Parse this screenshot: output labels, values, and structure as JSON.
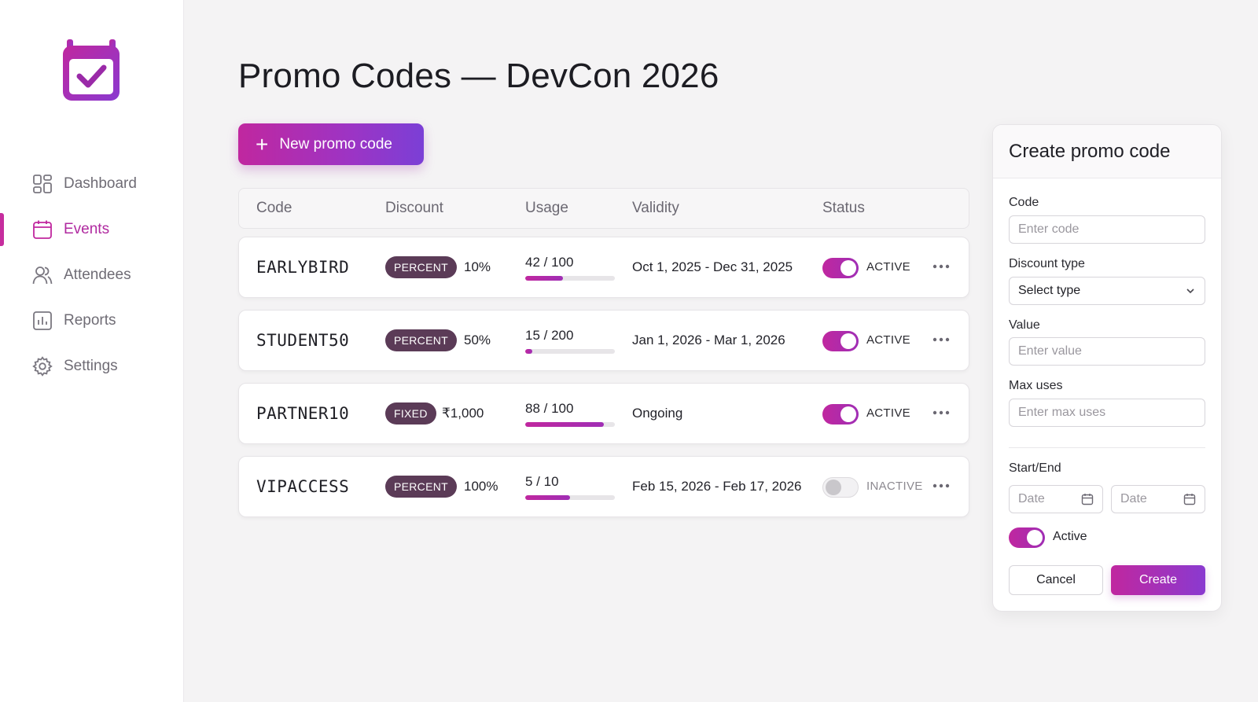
{
  "sidebar": {
    "items": [
      {
        "label": "Dashboard",
        "icon": "dashboard-icon"
      },
      {
        "label": "Events",
        "icon": "calendar-icon",
        "active": true
      },
      {
        "label": "Attendees",
        "icon": "users-icon"
      },
      {
        "label": "Reports",
        "icon": "chart-icon"
      },
      {
        "label": "Settings",
        "icon": "gear-icon"
      }
    ]
  },
  "page": {
    "title": "Promo Codes — DevCon 2026",
    "new_button": "New promo code"
  },
  "table": {
    "headers": [
      "Code",
      "Discount",
      "Usage",
      "Validity",
      "Status"
    ],
    "rows": [
      {
        "code": "EARLYBIRD",
        "type": "PERCENT",
        "value": "10%",
        "usage": "42 / 100",
        "usage_fraction": 0.42,
        "validity": "Oct 1, 2025 - Dec 31, 2025",
        "active": true,
        "status": "ACTIVE"
      },
      {
        "code": "STUDENT50",
        "type": "PERCENT",
        "value": "50%",
        "usage": "15 / 200",
        "usage_fraction": 0.075,
        "validity": "Jan 1, 2026 - Mar 1, 2026",
        "active": true,
        "status": "ACTIVE"
      },
      {
        "code": "PARTNER10",
        "type": "FIXED",
        "value": "₹1,000",
        "usage": "88 / 100",
        "usage_fraction": 0.88,
        "validity": "Ongoing",
        "active": true,
        "status": "ACTIVE"
      },
      {
        "code": "VIPACCESS",
        "type": "PERCENT",
        "value": "100%",
        "usage": "5 / 10",
        "usage_fraction": 0.5,
        "validity": "Feb 15, 2026 - Feb 17, 2026",
        "active": false,
        "status": "INACTIVE"
      }
    ]
  },
  "panel": {
    "title": "Create promo code",
    "code_label": "Code",
    "code_placeholder": "Enter code",
    "type_label": "Discount type",
    "type_value": "Select type",
    "value_label": "Value",
    "value_placeholder": "Enter value",
    "max_label": "Max uses",
    "max_placeholder": "Enter max uses",
    "dates_label": "Start/End",
    "start_placeholder": "Date",
    "end_placeholder": "Date",
    "active_label": "Active",
    "cancel": "Cancel",
    "create": "Create"
  },
  "colors": {
    "accent": "#c0279f",
    "accent_end": "#7b3fd6",
    "badge": "#5b3b57"
  }
}
